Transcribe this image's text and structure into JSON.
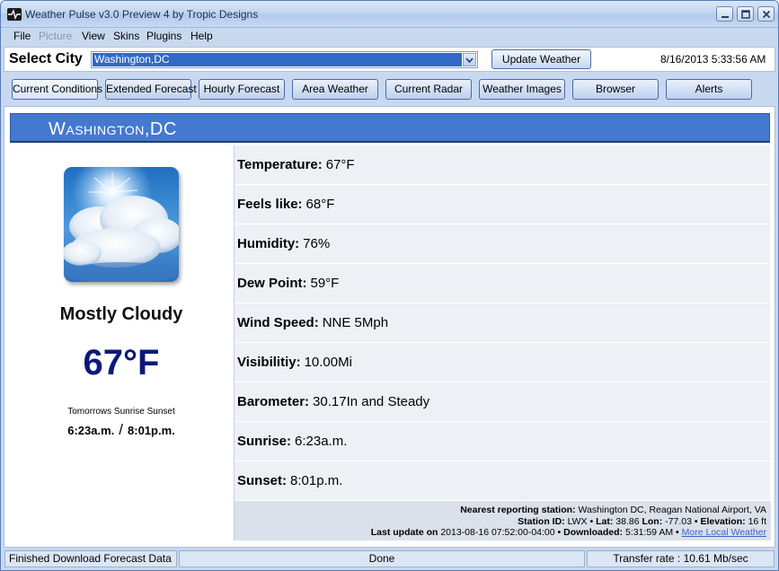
{
  "window": {
    "title": "Weather Pulse v3.0 Preview 4 by Tropic Designs"
  },
  "menu": [
    {
      "label": "File",
      "enabled": true
    },
    {
      "label": "Picture",
      "enabled": false
    },
    {
      "label": "View",
      "enabled": true
    },
    {
      "label": "Skins",
      "enabled": true
    },
    {
      "label": "Plugins",
      "enabled": true
    },
    {
      "label": "Help",
      "enabled": true
    }
  ],
  "city_row": {
    "label": "Select City",
    "selected_city": "Washington,DC",
    "update_button": "Update Weather",
    "datetime": "8/16/2013 5:33:56 AM"
  },
  "nav_buttons": [
    "Current Conditions",
    "Extended Forecast",
    "Hourly Forecast",
    "Area Weather",
    "Current Radar",
    "Weather Images",
    "Browser",
    "Alerts"
  ],
  "header": {
    "city": "Washington,DC"
  },
  "current": {
    "condition": "Mostly Cloudy",
    "temperature": "67°F",
    "sun_label": "Tomorrows Sunrise Sunset",
    "sunrise": "6:23a.m.",
    "sun_sep": "/",
    "sunset": "8:01p.m."
  },
  "stats": [
    {
      "label": "Temperature:",
      "value": "67°F"
    },
    {
      "label": "Feels like:",
      "value": "68°F"
    },
    {
      "label": "Humidity:",
      "value": "76%"
    },
    {
      "label": "Dew Point:",
      "value": "59°F"
    },
    {
      "label": "Wind Speed:",
      "value": "NNE 5Mph"
    },
    {
      "label": "Visibilitiy:",
      "value": "10.00Mi"
    },
    {
      "label": "Barometer:",
      "value": "30.17In and Steady"
    },
    {
      "label": "Sunrise:",
      "value": "6:23a.m."
    },
    {
      "label": "Sunset:",
      "value": "8:01p.m."
    }
  ],
  "station": {
    "nearest_label": "Nearest reporting station:",
    "nearest_value": "Washington DC, Reagan National Airport, VA",
    "id_label": "Station ID:",
    "id_value": "LWX",
    "lat_label": "Lat:",
    "lat_value": "38.86",
    "lon_label": "Lon:",
    "lon_value": "-77.03",
    "elev_label": "Elevation:",
    "elev_value": "16 ft",
    "update_label": "Last update on",
    "update_value": "2013-08-16 07:52:00-04:00",
    "downloaded_label": "Downloaded:",
    "downloaded_value": "5:31:59 AM",
    "more_link": "More Local Weather",
    "bullet": "•"
  },
  "status": {
    "left": "Finished Download Forecast Data",
    "middle": "Done",
    "right": "Transfer rate : 10.61 Mb/sec"
  },
  "colors": {
    "header_blue": "#4579d0",
    "temp_navy": "#0b1a7a",
    "link_blue": "#3a63c8"
  }
}
